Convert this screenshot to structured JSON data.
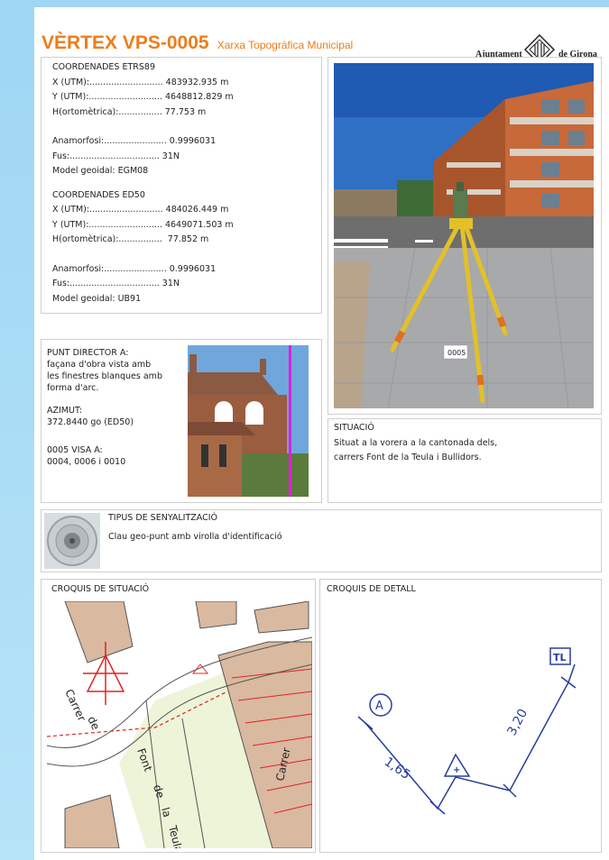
{
  "header": {
    "title": "VÈRTEX VPS-0005",
    "subtitle": "Xarxa Topogràfica Municipal",
    "logo_left": "Ajuntament",
    "logo_right": "de Girona"
  },
  "coords": {
    "etrs_title": "COORDENADES ETRS89",
    "etrs_x": "X (UTM):........................... 483932.935 m",
    "etrs_y": "Y (UTM):........................... 4648812.829 m",
    "etrs_h": "H(ortomètrica):................ 77.753 m",
    "etrs_anam": "Anamorfosi:....................... 0.9996031",
    "etrs_fus": "Fus:................................. 31N",
    "etrs_geoid": "Model geoidal: EGM08",
    "ed50_title": "COORDENADES ED50",
    "ed50_x": "X (UTM):........................... 484026.449 m",
    "ed50_y": "Y (UTM):........................... 4649071.503 m",
    "ed50_h": "H(ortomètrica):................  77.852 m",
    "ed50_anam": "Anamorfosi:....................... 0.9996031",
    "ed50_fus": "Fus:................................. 31N",
    "ed50_geoid": "Model geoidal: UB91"
  },
  "director": {
    "title": "PUNT DIRECTOR A:",
    "desc1": "façana d'obra vista amb",
    "desc2": "les finestres blanques amb",
    "desc3": "forma d'arc.",
    "azimut_title": "AZIMUT:",
    "azimut_value": "372.8440 go (ED50)",
    "visa_title": "0005 VISA A:",
    "visa_value": "0004, 0006 i 0010"
  },
  "situacio": {
    "title": "SITUACIÓ",
    "line1": "Situat a la vorera a la cantonada dels,",
    "line2": "carrers Font de la Teula i Bullidors."
  },
  "senyal": {
    "title": "TIPUS DE SENYALITZACIÓ",
    "desc": "Clau geo-punt amb virolla d'identificació"
  },
  "croquis": {
    "situacio_title": "CROQUIS DE SITUACIÓ",
    "detall_title": "CROQUIS DE DETALL",
    "street1": "Carrer",
    "street1b": "de",
    "street2": "Font",
    "street3": "de",
    "street4": "la",
    "street5": "Teula",
    "street6": "Carrer",
    "label_a": "A",
    "label_tl": "TL",
    "label_point": "+",
    "dist1": "1,65",
    "dist2": "3,20"
  },
  "photo_tag": "0005"
}
